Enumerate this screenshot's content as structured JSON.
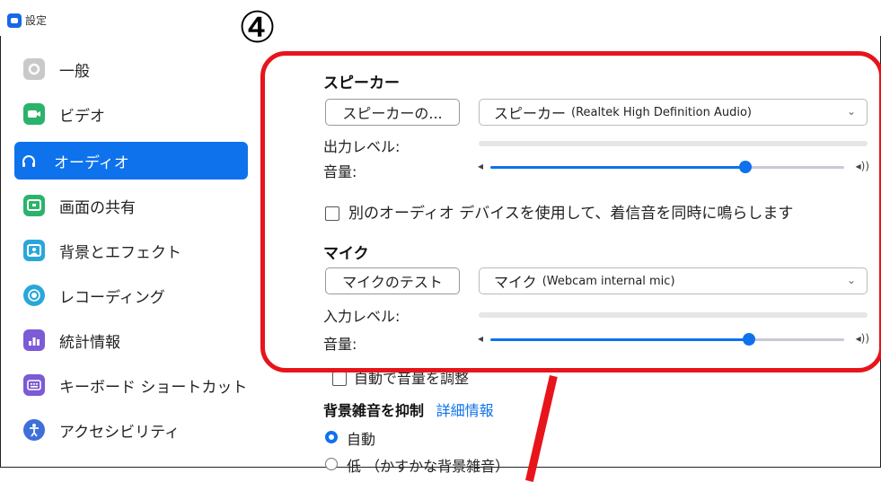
{
  "window": {
    "title": "設定",
    "badge": "④"
  },
  "sidebar": {
    "items": [
      {
        "label": "一般",
        "icon": "gear-icon",
        "color": "#c9c9c9"
      },
      {
        "label": "ビデオ",
        "icon": "video-camera-icon",
        "color": "#2cb36b"
      },
      {
        "label": "オーディオ",
        "icon": "headphones-icon",
        "color": "#0e72ed",
        "active": true
      },
      {
        "label": "画面の共有",
        "icon": "share-screen-icon",
        "color": "#2cb36b"
      },
      {
        "label": "背景とエフェクト",
        "icon": "background-icon",
        "color": "#2aa7d9"
      },
      {
        "label": "レコーディング",
        "icon": "record-icon",
        "color": "#2aa7d9"
      },
      {
        "label": "統計情報",
        "icon": "statistics-icon",
        "color": "#7b5bd6"
      },
      {
        "label": "キーボード ショートカット",
        "icon": "keyboard-icon",
        "color": "#7b5bd6"
      },
      {
        "label": "アクセシビリティ",
        "icon": "accessibility-icon",
        "color": "#3f6fd8"
      }
    ]
  },
  "speaker": {
    "heading": "スピーカー",
    "test_button": "スピーカーの...",
    "device_main": "スピーカー",
    "device_detail": "(Realtek High Definition Audio)",
    "output_level_label": "出力レベル:",
    "volume_label": "音量:",
    "volume_value": 0.72
  },
  "separate_device": {
    "label": "別のオーディオ デバイスを使用して、着信音を同時に鳴らします",
    "checked": false
  },
  "mic": {
    "heading": "マイク",
    "test_button": "マイクのテスト",
    "device_main": "マイク",
    "device_detail": "(Webcam internal mic)",
    "input_level_label": "入力レベル:",
    "volume_label": "音量:",
    "volume_value": 0.73
  },
  "auto_adjust": {
    "label": "自動で音量を調整"
  },
  "noise": {
    "heading": "背景雑音を抑制",
    "link": "詳細情報",
    "options": [
      {
        "label": "自動",
        "selected": true
      },
      {
        "label": "低 （かすかな背景雑音）",
        "selected": false
      }
    ]
  },
  "colors": {
    "accent": "#0e72ed",
    "highlight": "#e8141b"
  }
}
